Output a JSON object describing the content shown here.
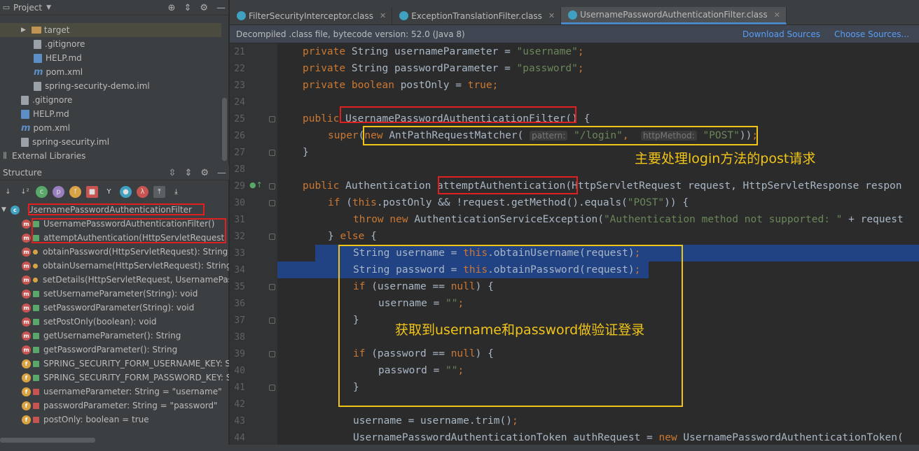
{
  "project_panel": {
    "title": "Project",
    "tree": [
      {
        "label": "target",
        "icon": "folder-icon",
        "indent": 1
      },
      {
        "label": ".gitignore",
        "icon": "file-icon",
        "indent": 2
      },
      {
        "label": "HELP.md",
        "icon": "markdown-icon",
        "indent": 2
      },
      {
        "label": "pom.xml",
        "icon": "maven-icon",
        "indent": 2
      },
      {
        "label": "spring-security-demo.iml",
        "icon": "module-file-icon",
        "indent": 2
      },
      {
        "label": ".gitignore",
        "icon": "file-icon",
        "indent": 1
      },
      {
        "label": "HELP.md",
        "icon": "markdown-icon",
        "indent": 1
      },
      {
        "label": "pom.xml",
        "icon": "maven-icon",
        "indent": 1
      },
      {
        "label": "spring-security.iml",
        "icon": "module-file-icon",
        "indent": 1
      },
      {
        "label": "External Libraries",
        "icon": "library-icon",
        "indent": 0
      }
    ]
  },
  "structure_panel": {
    "title": "Structure",
    "root": "UsernamePasswordAuthenticationFilter",
    "members": [
      {
        "label": "UsernamePasswordAuthenticationFilter()",
        "kind": "m",
        "vis": "pub"
      },
      {
        "label": "attemptAuthentication(HttpServletRequest, Ht",
        "kind": "m",
        "vis": "pub"
      },
      {
        "label": "obtainPassword(HttpServletRequest): String",
        "kind": "m",
        "vis": "prot"
      },
      {
        "label": "obtainUsername(HttpServletRequest): String",
        "kind": "m",
        "vis": "prot"
      },
      {
        "label": "setDetails(HttpServletRequest, UsernamePass",
        "kind": "m",
        "vis": "prot"
      },
      {
        "label": "setUsernameParameter(String): void",
        "kind": "m",
        "vis": "pub"
      },
      {
        "label": "setPasswordParameter(String): void",
        "kind": "m",
        "vis": "pub"
      },
      {
        "label": "setPostOnly(boolean): void",
        "kind": "m",
        "vis": "pub"
      },
      {
        "label": "getUsernameParameter(): String",
        "kind": "m",
        "vis": "pub"
      },
      {
        "label": "getPasswordParameter(): String",
        "kind": "m",
        "vis": "pub"
      },
      {
        "label": "SPRING_SECURITY_FORM_USERNAME_KEY: S",
        "kind": "f",
        "vis": "pub"
      },
      {
        "label": "SPRING_SECURITY_FORM_PASSWORD_KEY: S",
        "kind": "f",
        "vis": "pub"
      },
      {
        "label": "usernameParameter: String = \"username\"",
        "kind": "f",
        "vis": "priv"
      },
      {
        "label": "passwordParameter: String = \"password\"",
        "kind": "f",
        "vis": "priv"
      },
      {
        "label": "postOnly: boolean = true",
        "kind": "f",
        "vis": "priv"
      }
    ]
  },
  "tabs": [
    {
      "label": "FilterSecurityInterceptor.class",
      "active": false
    },
    {
      "label": "ExceptionTranslationFilter.class",
      "active": false
    },
    {
      "label": "UsernamePasswordAuthenticationFilter.class",
      "active": true
    }
  ],
  "banner": {
    "text": "Decompiled .class file, bytecode version: 52.0 (Java 8)",
    "download_sources": "Download Sources",
    "choose_sources": "Choose Sources..."
  },
  "line_numbers": [
    "21",
    "22",
    "23",
    "24",
    "25",
    "26",
    "27",
    "28",
    "29",
    "30",
    "31",
    "32",
    "33",
    "34",
    "35",
    "36",
    "37",
    "38",
    "39",
    "40",
    "41",
    "42",
    "43",
    "44"
  ],
  "code": {
    "l21": "private String usernameParameter = \"username\";",
    "l22": "private String passwordParameter = \"password\";",
    "l23": "private boolean postOnly = true;",
    "l25": "public UsernamePasswordAuthenticationFilter() {",
    "l26a": "super(new AntPathRequestMatcher(",
    "l26_hint1": "pattern:",
    "l26b": "\"/login\",",
    "l26_hint2": "httpMethod:",
    "l26c": "\"POST\"));",
    "l27": "}",
    "l29": "public Authentication attemptAuthentication(HttpServletRequest request, HttpServletResponse respon",
    "l30": "if (this.postOnly && !request.getMethod().equals(\"POST\")) {",
    "l31": "throw new AuthenticationServiceException(\"Authentication method not supported: \" + request",
    "l32": "} else {",
    "l33": "String username = this.obtainUsername(request);",
    "l34": "String password = this.obtainPassword(request);",
    "l35": "if (username == null) {",
    "l36": "username = \"\";",
    "l37": "}",
    "l39": "if (password == null) {",
    "l40": "password = \"\";",
    "l41": "}",
    "l43": "username = username.trim();",
    "l44": "UsernamePasswordAuthenticationToken authRequest = new UsernamePasswordAuthenticationToken("
  },
  "annotations": {
    "note1": "主要处理login方法的post请求",
    "note2": "获取到username和password做验证登录"
  },
  "colors": {
    "keyword": "#cc7832",
    "string": "#6a8759",
    "selection": "#214283",
    "annotation_red": "#e02020",
    "annotation_yellow": "#f0c419"
  }
}
